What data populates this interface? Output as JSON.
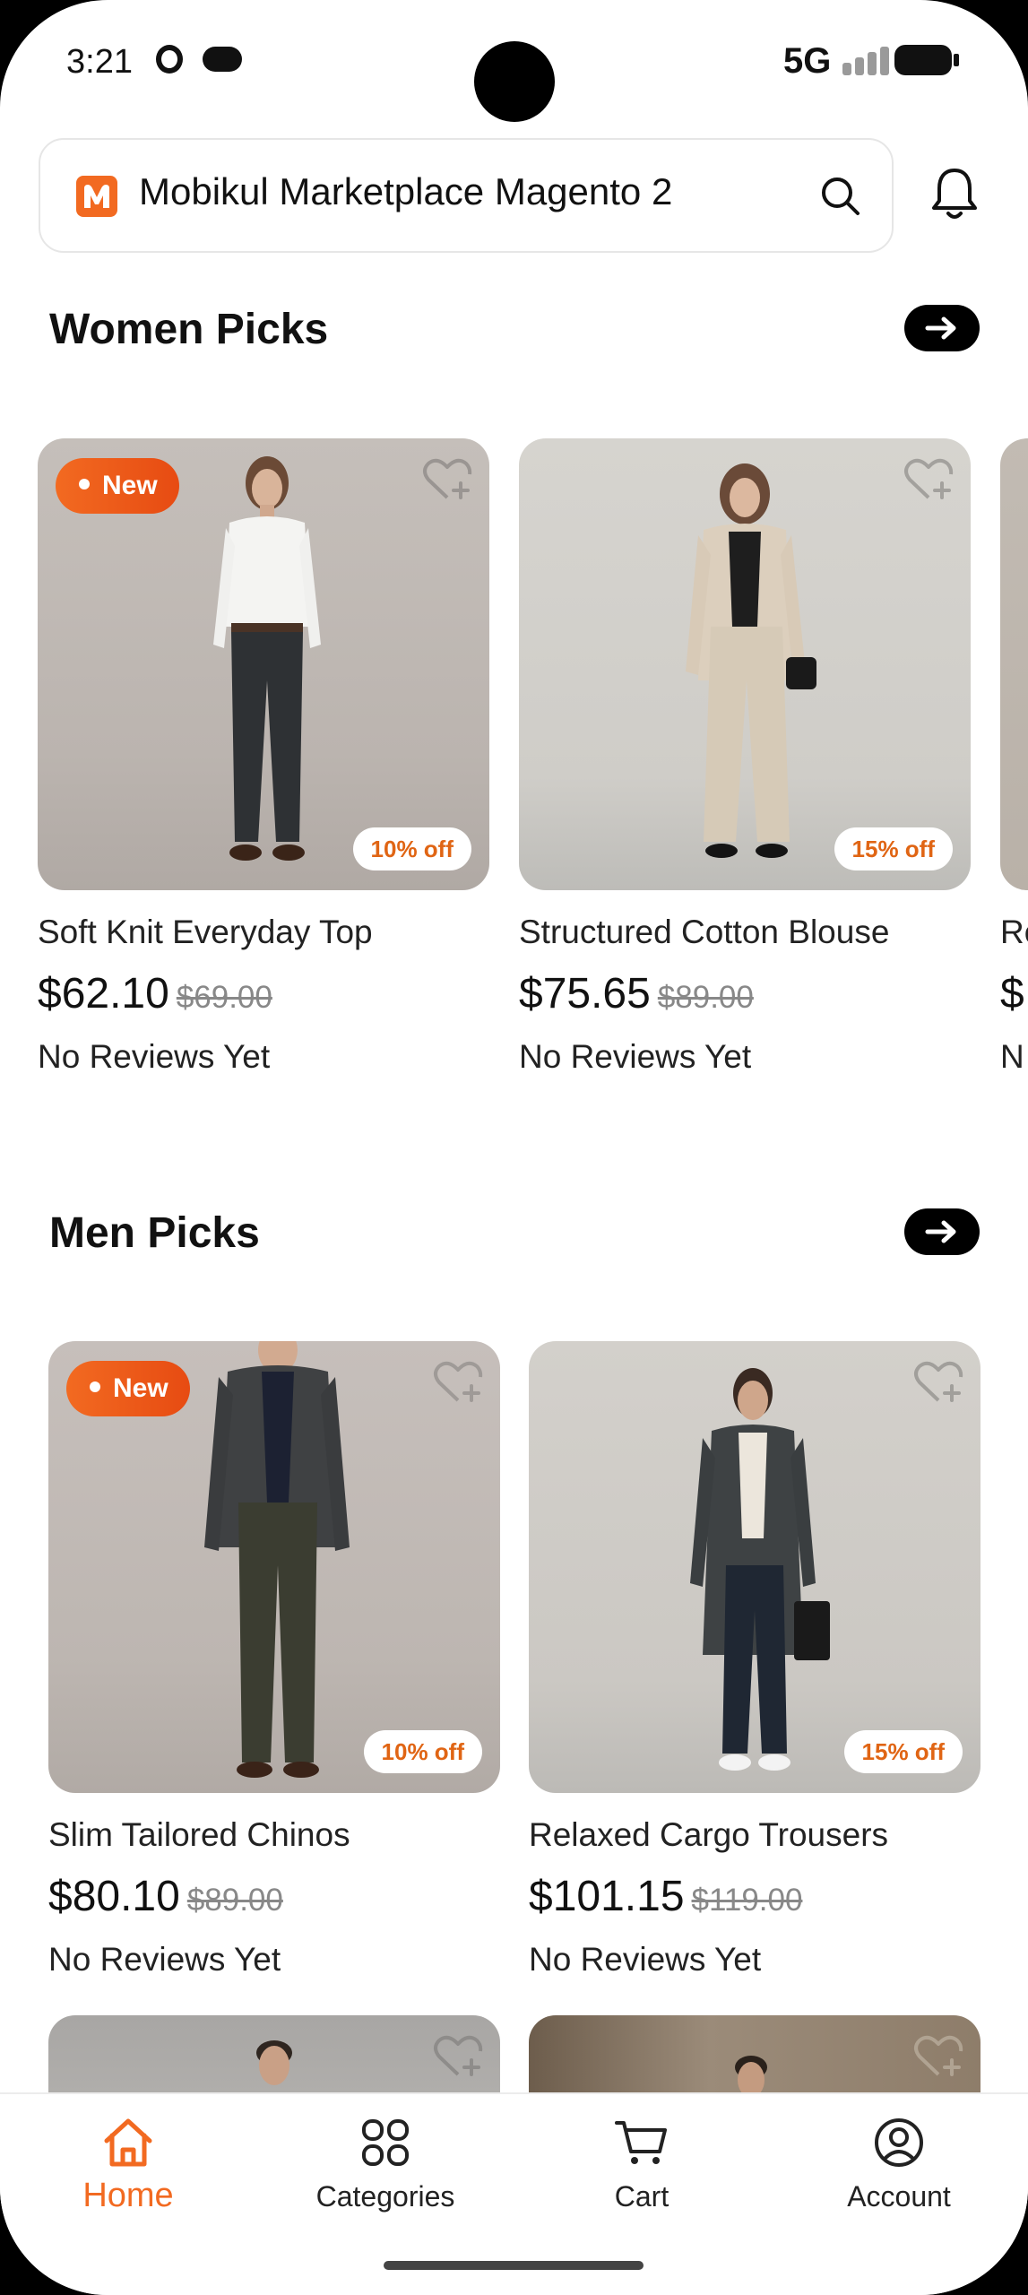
{
  "status_bar": {
    "time": "3:21",
    "network": "5G"
  },
  "search": {
    "title": "Mobikul Marketplace Magento 2"
  },
  "sections": [
    {
      "title": "Women Picks",
      "products": [
        {
          "name": "Soft Knit Everyday Top",
          "price": "$62.10",
          "old_price": "$69.00",
          "reviews": "No Reviews Yet",
          "badge": "New",
          "discount": "10% off"
        },
        {
          "name": "Structured Cotton Blouse",
          "price": "$75.65",
          "old_price": "$89.00",
          "reviews": "No Reviews Yet",
          "badge": "",
          "discount": "15% off"
        },
        {
          "name": "Re",
          "price": "$",
          "reviews": "N"
        }
      ]
    },
    {
      "title": "Men Picks",
      "products": [
        {
          "name": "Slim Tailored Chinos",
          "price": "$80.10",
          "old_price": "$89.00",
          "reviews": "No Reviews Yet",
          "badge": "New",
          "discount": "10% off"
        },
        {
          "name": "Relaxed Cargo Trousers",
          "price": "$101.15",
          "old_price": "$119.00",
          "reviews": "No Reviews Yet",
          "badge": "",
          "discount": "15% off"
        }
      ]
    }
  ],
  "bottom_nav": {
    "items": [
      {
        "label": "Home",
        "icon": "home-icon",
        "active": true
      },
      {
        "label": "Categories",
        "icon": "categories-icon",
        "active": false
      },
      {
        "label": "Cart",
        "icon": "cart-icon",
        "active": false
      },
      {
        "label": "Account",
        "icon": "account-icon",
        "active": false
      }
    ]
  },
  "colors": {
    "accent": "#f26a21",
    "text": "#111111",
    "muted": "#888888"
  }
}
